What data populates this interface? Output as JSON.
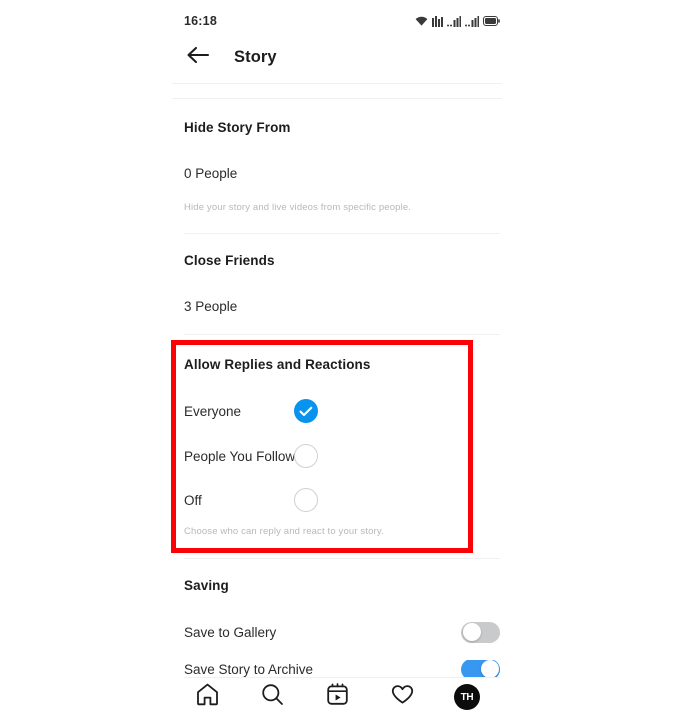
{
  "status_bar": {
    "time": "16:18",
    "icons": [
      "wifi-icon",
      "signal-icon",
      "signal-bars-icon",
      "signal-bars-icon",
      "battery-icon"
    ]
  },
  "header": {
    "back_icon": "back-arrow-icon",
    "title": "Story"
  },
  "sections": {
    "hide_story": {
      "title": "Hide Story From",
      "value": "0 People",
      "helper": "Hide your story and live videos from specific people."
    },
    "close_friends": {
      "title": "Close Friends",
      "value": "3 People"
    },
    "allow_replies": {
      "title": "Allow Replies and Reactions",
      "helper": "Choose who can reply and react to your story.",
      "options": [
        {
          "label": "Everyone",
          "selected": true
        },
        {
          "label": "People You Follow",
          "selected": false
        },
        {
          "label": "Off",
          "selected": false
        }
      ],
      "highlight_color": "#fb0207",
      "selected_color": "#0a93ee"
    },
    "saving": {
      "title": "Saving",
      "rows": [
        {
          "label": "Save to Gallery",
          "enabled": false
        },
        {
          "label": "Save Story to Archive",
          "enabled": true
        }
      ],
      "toggle_on_color": "#3897f0",
      "toggle_off_color": "#c9cacc"
    }
  },
  "bottom_nav": {
    "items": [
      {
        "name": "home-icon",
        "label": "Home"
      },
      {
        "name": "search-icon",
        "label": "Search"
      },
      {
        "name": "reels-icon",
        "label": "Reels"
      },
      {
        "name": "heart-icon",
        "label": "Activity"
      },
      {
        "name": "profile-avatar",
        "label": "TH"
      }
    ]
  }
}
